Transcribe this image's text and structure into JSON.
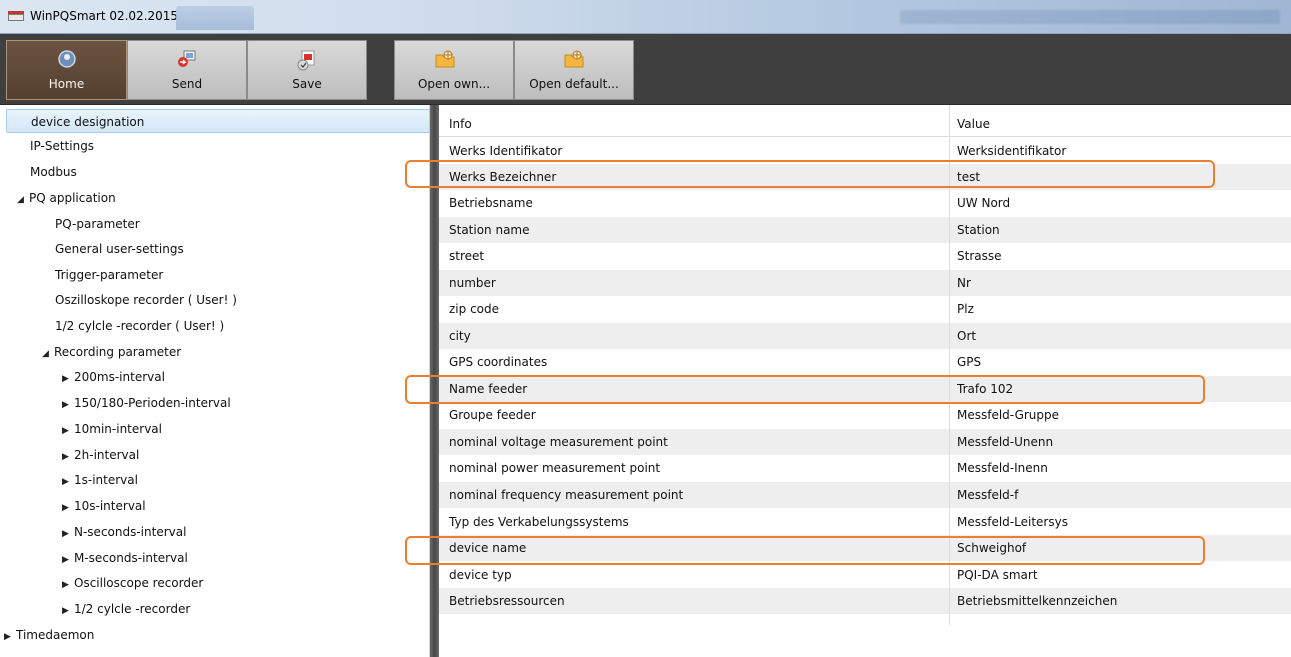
{
  "window": {
    "title": "WinPQSmart 02.02.2015"
  },
  "toolbar": {
    "home_label": "Home",
    "send_label": "Send",
    "save_label": "Save",
    "open_own_label": "Open own...",
    "open_default_label": "Open default..."
  },
  "tree": {
    "device_designation": "device designation",
    "ip_settings": "IP-Settings",
    "modbus": "Modbus",
    "pq_application": "PQ application",
    "pq_parameter": "PQ-parameter",
    "general_user_settings": "General user-settings",
    "trigger_parameter": "Trigger-parameter",
    "oszilloskope_recorder": "Oszilloskope recorder ( User! )",
    "half_cycle_recorder_user": "1/2 cylcle -recorder ( User! )",
    "recording_parameter": "Recording parameter",
    "i200ms": "200ms-interval",
    "i150_180": "150/180-Perioden-interval",
    "i10min": "10min-interval",
    "i2h": "2h-interval",
    "i1s": "1s-interval",
    "i10s": "10s-interval",
    "n_seconds": "N-seconds-interval",
    "m_seconds": "M-seconds-interval",
    "oscilloscope_recorder": "Oscilloscope recorder",
    "half_cycle_recorder": "1/2 cylcle -recorder",
    "timedaemon": "Timedaemon"
  },
  "grid": {
    "header": {
      "info": "Info",
      "value": "Value"
    },
    "rows": [
      {
        "info": "Werks Identifikator",
        "value": "Werksidentifikator"
      },
      {
        "info": "Werks Bezeichner",
        "value": "test"
      },
      {
        "info": "Betriebsname",
        "value": "UW Nord"
      },
      {
        "info": "Station name",
        "value": "Station"
      },
      {
        "info": "street",
        "value": "Strasse"
      },
      {
        "info": "number",
        "value": "Nr"
      },
      {
        "info": "zip code",
        "value": "Plz"
      },
      {
        "info": "city",
        "value": "Ort"
      },
      {
        "info": "GPS coordinates",
        "value": "GPS"
      },
      {
        "info": "Name feeder",
        "value": "Trafo 102"
      },
      {
        "info": "Groupe feeder",
        "value": "Messfeld-Gruppe"
      },
      {
        "info": "nominal voltage measurement point",
        "value": "Messfeld-Unenn"
      },
      {
        "info": "nominal power measurement point",
        "value": "Messfeld-Inenn"
      },
      {
        "info": "nominal frequency measurement point",
        "value": "Messfeld-f"
      },
      {
        "info": "Typ des Verkabelungssystems",
        "value": "Messfeld-Leitersys"
      },
      {
        "info": "device name",
        "value": "Schweighof"
      },
      {
        "info": "device typ",
        "value": "PQI-DA smart"
      },
      {
        "info": "Betriebsressourcen",
        "value": "Betriebsmittelkennzeichen"
      }
    ]
  },
  "colors": {
    "highlight": "#ed7d31",
    "selection": "#d3e7f8",
    "toolbar": "#3f3f3f"
  }
}
